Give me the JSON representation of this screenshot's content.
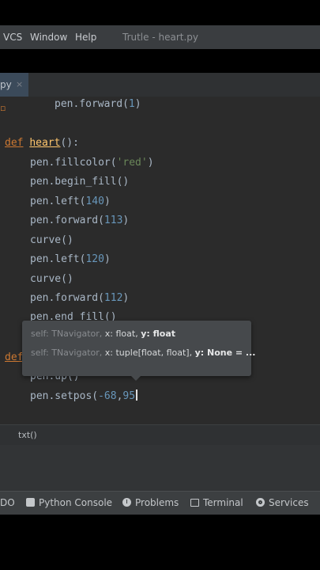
{
  "menu": {
    "vcs": "VCS",
    "window": "Window",
    "help": "Help",
    "title": "Trutle - heart.py"
  },
  "tab": {
    "label": "py",
    "close": "×"
  },
  "code": {
    "l1": {
      "call": "pen.forward(",
      "num": "1",
      "end": ")"
    },
    "l2": {
      "kw": "def",
      "name": "heart",
      "end": "():"
    },
    "l3": {
      "call": "pen.fillcolor(",
      "str": "'red'",
      "end": ")"
    },
    "l4": {
      "call": "pen.begin_fill()"
    },
    "l5": {
      "call": "pen.left(",
      "num": "140",
      "end": ")"
    },
    "l6": {
      "call": "pen.forward(",
      "num": "113",
      "end": ")"
    },
    "l7": {
      "call": "curve()"
    },
    "l8": {
      "call": "pen.left(",
      "num": "120",
      "end": ")"
    },
    "l9": {
      "call": "curve()"
    },
    "l10": {
      "call": "pen.forward(",
      "num": "112",
      "end": ")"
    },
    "l11": {
      "call": "pen.end_fill()"
    },
    "l12": {
      "kw": "def"
    },
    "l13": {
      "call": "pen.up()"
    },
    "l14": {
      "call": "pen.setpos(",
      "num1": "-68",
      "sep": ",",
      "num2": "95"
    }
  },
  "hint": {
    "row1_self": "self: TNavigator,",
    "row1_x": "x: float,",
    "row1_y": "y: float",
    "row2_self": "self: TNavigator,",
    "row2_x": "x: tuple[float, float],",
    "row2_y": "y: None = ..."
  },
  "breadcrumb": {
    "text": "txt()"
  },
  "toolbar": {
    "todo": "DO",
    "python_console": "Python Console",
    "problems": "Problems",
    "terminal": "Terminal",
    "services": "Services"
  }
}
